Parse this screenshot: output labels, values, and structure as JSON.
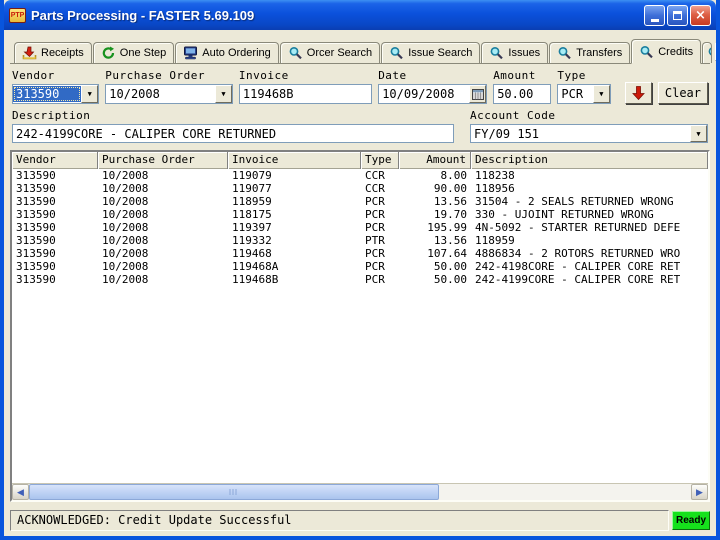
{
  "window": {
    "title": "Parts Processing - FASTER 5.69.109",
    "icon_text": "PTP"
  },
  "tabs": [
    {
      "label": "Receipts",
      "icon": "receive-icon",
      "active": false,
      "partial": false
    },
    {
      "label": "One Step",
      "icon": "refresh-icon",
      "active": false,
      "partial": false
    },
    {
      "label": "Auto Ordering",
      "icon": "computer-icon",
      "active": false,
      "partial": false
    },
    {
      "label": "Orcer Search",
      "icon": "search-icon",
      "active": false,
      "partial": false
    },
    {
      "label": "Issue Search",
      "icon": "search-icon",
      "active": false,
      "partial": false
    },
    {
      "label": "Issues",
      "icon": "search-icon",
      "active": false,
      "partial": false
    },
    {
      "label": "Transfers",
      "icon": "search-icon",
      "active": false,
      "partial": false
    },
    {
      "label": "Credits",
      "icon": "search-icon",
      "active": true,
      "partial": false
    },
    {
      "label": "",
      "icon": "search-icon",
      "active": false,
      "partial": true
    }
  ],
  "tab_scroller": {
    "left": "◀",
    "right": "▶"
  },
  "form": {
    "vendor": {
      "label": "Vendor",
      "value": "313590"
    },
    "purchase_order": {
      "label": "Purchase Order",
      "value": "10/2008"
    },
    "invoice": {
      "label": "Invoice",
      "value": "119468B"
    },
    "date": {
      "label": "Date",
      "value": "10/09/2008"
    },
    "amount": {
      "label": "Amount",
      "value": "50.00"
    },
    "type": {
      "label": "Type",
      "value": "PCR"
    },
    "clear_label": "Clear",
    "description": {
      "label": "Description",
      "value": "242-4199CORE - CALIPER CORE RETURNED"
    },
    "account_code": {
      "label": "Account Code",
      "value": "FY/09 151"
    }
  },
  "table": {
    "columns": [
      "Vendor",
      "Purchase Order",
      "Invoice",
      "Type",
      "Amount",
      "Description"
    ],
    "rows": [
      [
        "313590",
        "10/2008",
        "119079",
        "CCR",
        "8.00",
        "118238"
      ],
      [
        "313590",
        "10/2008",
        "119077",
        "CCR",
        "90.00",
        "118956"
      ],
      [
        "313590",
        "10/2008",
        "118959",
        "PCR",
        "13.56",
        "31504 - 2 SEALS RETURNED WRONG"
      ],
      [
        "313590",
        "10/2008",
        "118175",
        "PCR",
        "19.70",
        "330 - UJOINT RETURNED WRONG"
      ],
      [
        "313590",
        "10/2008",
        "119397",
        "PCR",
        "195.99",
        "4N-5092 - STARTER RETURNED DEFE"
      ],
      [
        "313590",
        "10/2008",
        "119332",
        "PTR",
        "13.56",
        "118959"
      ],
      [
        "313590",
        "10/2008",
        "119468",
        "PCR",
        "107.64",
        "4886834 - 2 ROTORS RETURNED WRO"
      ],
      [
        "313590",
        "10/2008",
        "119468A",
        "PCR",
        "50.00",
        "242-4198CORE - CALIPER CORE RET"
      ],
      [
        "313590",
        "10/2008",
        "119468B",
        "PCR",
        "50.00",
        "242-4199CORE - CALIPER CORE RET"
      ]
    ]
  },
  "status_bar": {
    "message": "ACKNOWLEDGED: Credit Update Successful",
    "ready_label": "Ready"
  },
  "colors": {
    "titlebar_blue": "#0B51DC",
    "window_border": "#0855DD",
    "client_beige": "#ECE9D8",
    "selection_blue": "#316AC5",
    "ready_green": "#16E11C",
    "post_arrow_red": "#CC1A0A"
  }
}
